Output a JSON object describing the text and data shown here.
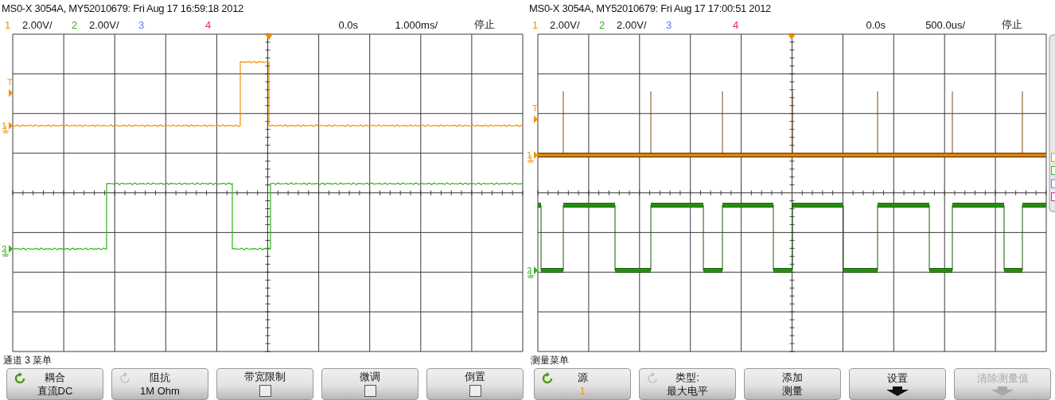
{
  "scopes": [
    {
      "title": "MS0-X 3054A, MY52010679: Fri Aug 17 16:59:18 2012",
      "channels": [
        {
          "number": "1",
          "scale": "2.00V/",
          "color": "#f39000"
        },
        {
          "number": "2",
          "scale": "2.00V/",
          "color": "#2fb418"
        },
        {
          "number": "3",
          "color": "#5b7cf0"
        },
        {
          "number": "4",
          "color": "#f0207c"
        }
      ],
      "time_offset": "0.0s",
      "time_scale": "1.000ms/",
      "status": "停止",
      "markers": [
        {
          "kind": "trigger",
          "label": "T",
          "color": "#f39000"
        },
        {
          "kind": "channel",
          "label": "1",
          "color": "#f39000"
        },
        {
          "kind": "channel",
          "label": "2",
          "color": "#2fb418"
        }
      ],
      "side_tab": false,
      "menu_title": "通道 3 菜单",
      "softkeys": [
        {
          "kind": "value",
          "label": "耦合",
          "value": "直流DC",
          "knob": true,
          "knob_active": true,
          "disabled": false
        },
        {
          "kind": "value",
          "label": "阻抗",
          "value": "1M Ohm",
          "knob": true,
          "knob_active": false,
          "disabled": false
        },
        {
          "kind": "checkbox",
          "label": "带宽限制",
          "checked": false,
          "knob": false,
          "disabled": false
        },
        {
          "kind": "checkbox",
          "label": "微调",
          "checked": false,
          "knob": false,
          "disabled": false
        },
        {
          "kind": "checkbox",
          "label": "倒置",
          "checked": false,
          "knob": false,
          "disabled": false
        }
      ]
    },
    {
      "title": "MS0-X 3054A, MY52010679: Fri Aug 17 17:00:51 2012",
      "channels": [
        {
          "number": "1",
          "scale": "2.00V/",
          "color": "#f39000"
        },
        {
          "number": "2",
          "scale": "2.00V/",
          "color": "#2fb418"
        },
        {
          "number": "3",
          "color": "#5b7cf0"
        },
        {
          "number": "4",
          "color": "#f0207c"
        }
      ],
      "time_offset": "0.0s",
      "time_scale": "500.0us/",
      "status": "停止",
      "markers": [
        {
          "kind": "trigger",
          "label": "T",
          "color": "#f39000"
        },
        {
          "kind": "channel",
          "label": "1",
          "color": "#f39000"
        },
        {
          "kind": "channel",
          "label": "2",
          "color": "#2fb418"
        }
      ],
      "side_tab": true,
      "menu_title": "测量菜单",
      "softkeys": [
        {
          "kind": "value",
          "label": "源",
          "value": "1",
          "color": "#f39000",
          "knob": true,
          "knob_active": true,
          "disabled": false
        },
        {
          "kind": "value",
          "label": "类型:",
          "value": "最大电平",
          "knob": true,
          "knob_active": false,
          "disabled": false
        },
        {
          "kind": "value",
          "label": "添加",
          "value": "测量",
          "knob": false,
          "disabled": false
        },
        {
          "kind": "arrow",
          "label": "设置",
          "knob": false,
          "disabled": false
        },
        {
          "kind": "arrow",
          "label": "清除测量值",
          "knob": false,
          "disabled": true
        }
      ]
    }
  ]
}
